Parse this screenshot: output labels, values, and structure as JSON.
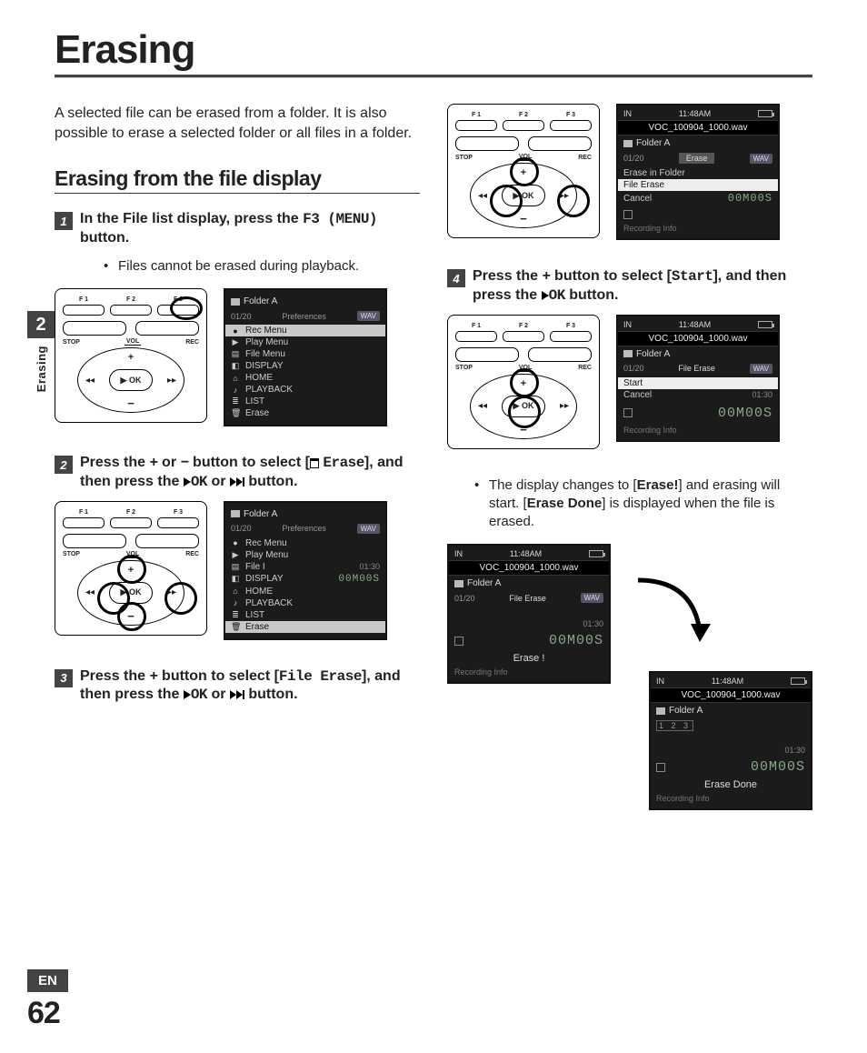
{
  "page": {
    "title": "Erasing",
    "intro": "A selected file can be erased from a folder. It is also possible to erase a selected folder or all files in a folder.",
    "section_heading": "Erasing from the file display",
    "chapter_num": "2",
    "side_label": "Erasing",
    "lang": "EN",
    "page_number": "62"
  },
  "steps": {
    "s1": {
      "num": "1",
      "line1": "In the File list display, press the ",
      "line2_mono": "F3 (MENU)",
      "line2_after": " button.",
      "bullet1": "Files cannot be erased during playback."
    },
    "s2": {
      "num": "2",
      "pre": "Press the ",
      "plus": "+",
      "or": " or ",
      "minus": "−",
      "mid": " button to select [",
      "erase": "Erase",
      "after1": "], and then press the ",
      "ok": "OK",
      "or2": " or ",
      "after2": " button."
    },
    "s3": {
      "num": "3",
      "pre": "Press the ",
      "plus": "+",
      "mid": " button to select [",
      "fe": "File Erase",
      "after1": "], and then press the ",
      "ok": "OK",
      "or2": " or ",
      "after2": " button."
    },
    "s4": {
      "num": "4",
      "pre": "Press the ",
      "plus": "+",
      "mid": " button to select [",
      "start": "Start",
      "after1": "], and then press the ",
      "ok": "OK",
      "after2": " button.",
      "bullet_pre": "The display changes to [",
      "b1": "Erase!",
      "bullet_mid": "] and erasing will start. [",
      "b2": "Erase Done",
      "bullet_after": "] is displayed when the file is erased."
    }
  },
  "device": {
    "f1": "F 1",
    "f2": "F 2",
    "f3": "F 3",
    "stop": "STOP",
    "vol": "VOL",
    "rec": "REC",
    "ok": "▶ OK",
    "plus": "+",
    "minus": "−",
    "lar": "◂◂",
    "rar": "▸▸"
  },
  "lcds": {
    "menu1": {
      "folder": "Folder A",
      "counter": "01/20",
      "pref": "Preferences",
      "wav": "WAV",
      "items": [
        {
          "icon": "●",
          "label": "Rec Menu"
        },
        {
          "icon": "▶",
          "label": "Play Menu"
        },
        {
          "icon": "▤",
          "label": "File Menu"
        },
        {
          "icon": "◧",
          "label": "DISPLAY"
        },
        {
          "icon": "⌂",
          "label": "HOME"
        },
        {
          "icon": "♪",
          "label": "PLAYBACK"
        },
        {
          "icon": "≣",
          "label": "LIST"
        },
        {
          "icon": "🗑",
          "label": "Erase"
        }
      ]
    },
    "menu2": {
      "folder": "Folder A",
      "counter": "01/20",
      "pref": "Preferences",
      "wav": "WAV",
      "time": "01:30",
      "seg": "00M00S",
      "items": [
        {
          "icon": "●",
          "label": "Rec Menu"
        },
        {
          "icon": "▶",
          "label": "Play Menu"
        },
        {
          "icon": "▤",
          "label": "File I"
        },
        {
          "icon": "◧",
          "label": "DISPLAY"
        },
        {
          "icon": "⌂",
          "label": "HOME"
        },
        {
          "icon": "♪",
          "label": "PLAYBACK"
        },
        {
          "icon": "≣",
          "label": "LIST"
        },
        {
          "icon": "🗑",
          "label": "Erase"
        }
      ]
    },
    "erase_menu": {
      "in": "IN",
      "time": "11:48AM",
      "file": "VOC_100904_1000.wav",
      "folder": "Folder A",
      "counter": "01/20",
      "mode": "Erase",
      "wav": "WAV",
      "i1": "Erase in Folder",
      "i2": "File Erase",
      "i3": "Cancel",
      "seg": "00M00S",
      "rec": "Recording Info"
    },
    "start_menu": {
      "in": "IN",
      "time": "11:48AM",
      "file": "VOC_100904_1000.wav",
      "folder": "Folder A",
      "counter": "01/20",
      "mode": "File Erase",
      "wav": "WAV",
      "i1": "Start",
      "i2": "Cancel",
      "t2": "01:30",
      "seg": "00M00S",
      "rec": "Recording Info"
    },
    "erasing": {
      "in": "IN",
      "time": "11:48AM",
      "file": "VOC_100904_1000.wav",
      "folder": "Folder A",
      "counter": "01/20",
      "mode": "File Erase",
      "wav": "WAV",
      "t2": "01:30",
      "seg": "00M00S",
      "msg": "Erase !",
      "rec": "Recording Info"
    },
    "done": {
      "in": "IN",
      "time": "11:48AM",
      "file": "VOC_100904_1000.wav",
      "folder": "Folder A",
      "boxes": "1 2 3",
      "t2": "01:30",
      "seg": "00M00S",
      "msg": "Erase Done",
      "rec": "Recording Info"
    }
  }
}
